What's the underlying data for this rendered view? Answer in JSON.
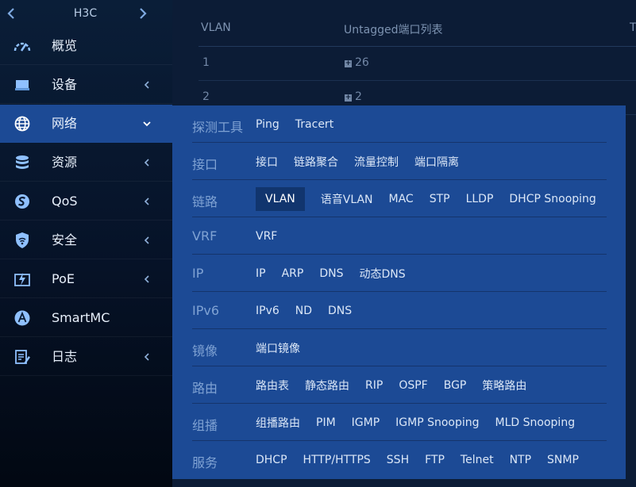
{
  "brand": {
    "name": "H3C"
  },
  "nav": {
    "items": [
      {
        "icon": "gauge-icon",
        "label": "概览",
        "chevron": "",
        "active": false
      },
      {
        "icon": "device-icon",
        "label": "设备",
        "chevron": "‹",
        "active": false
      },
      {
        "icon": "globe-icon",
        "label": "网络",
        "chevron": "⌄",
        "active": true
      },
      {
        "icon": "database-icon",
        "label": "资源",
        "chevron": "‹",
        "active": false
      },
      {
        "icon": "qos-icon",
        "label": "QoS",
        "chevron": "‹",
        "active": false
      },
      {
        "icon": "shield-wifi-icon",
        "label": "安全",
        "chevron": "‹",
        "active": false
      },
      {
        "icon": "poe-icon",
        "label": "PoE",
        "chevron": "‹",
        "active": false
      },
      {
        "icon": "smartmc-icon",
        "label": "SmartMC",
        "chevron": "",
        "active": false
      },
      {
        "icon": "log-icon",
        "label": "日志",
        "chevron": "‹",
        "active": false
      }
    ]
  },
  "table": {
    "headers": [
      "VLAN",
      "Untagged端口列表",
      "T"
    ],
    "rows": [
      {
        "vlan": "1",
        "untagged": "26"
      },
      {
        "vlan": "2",
        "untagged": "2"
      }
    ]
  },
  "panel": {
    "rows": [
      {
        "category": "探测工具",
        "links": [
          "Ping",
          "Tracert"
        ]
      },
      {
        "category": "接口",
        "links": [
          "接口",
          "链路聚合",
          "流量控制",
          "端口隔离"
        ]
      },
      {
        "category": "链路",
        "links": [
          "VLAN",
          "语音VLAN",
          "MAC",
          "STP",
          "LLDP",
          "DHCP Snooping"
        ],
        "selected": "VLAN"
      },
      {
        "category": "VRF",
        "links": [
          "VRF"
        ]
      },
      {
        "category": "IP",
        "links": [
          "IP",
          "ARP",
          "DNS",
          "动态DNS"
        ]
      },
      {
        "category": "IPv6",
        "links": [
          "IPv6",
          "ND",
          "DNS"
        ]
      },
      {
        "category": "镜像",
        "links": [
          "端口镜像"
        ]
      },
      {
        "category": "路由",
        "links": [
          "路由表",
          "静态路由",
          "RIP",
          "OSPF",
          "BGP",
          "策略路由"
        ]
      },
      {
        "category": "组播",
        "links": [
          "组播路由",
          "PIM",
          "IGMP",
          "IGMP Snooping",
          "MLD Snooping"
        ]
      },
      {
        "category": "服务",
        "links": [
          "DHCP",
          "HTTP/HTTPS",
          "SSH",
          "FTP",
          "Telnet",
          "NTP",
          "SNMP"
        ]
      }
    ]
  },
  "colors": {
    "accent": "#1c4a95",
    "sidebar": "#061227",
    "background": "#0c1c36",
    "icon": "#8fc0ff"
  }
}
